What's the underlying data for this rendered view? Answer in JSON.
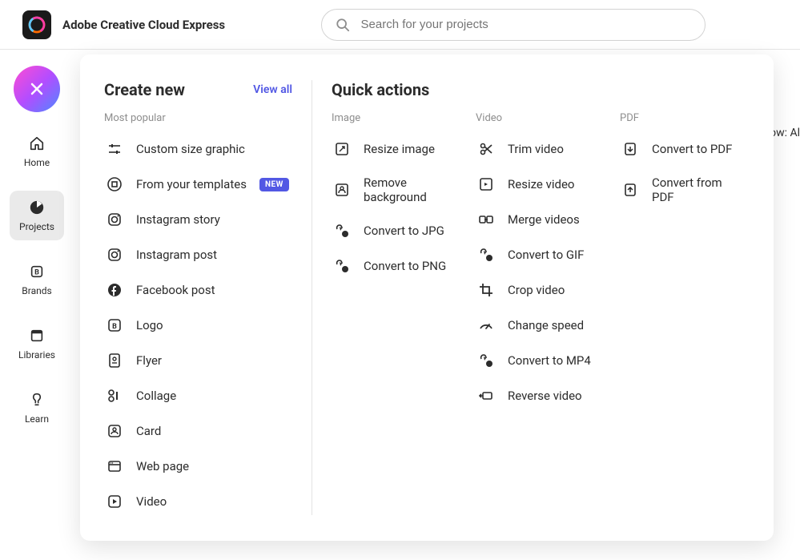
{
  "header": {
    "title": "Adobe Creative Cloud Express",
    "search_placeholder": "Search for your projects"
  },
  "sidebar": {
    "items": [
      {
        "label": "Home",
        "icon": "home-icon"
      },
      {
        "label": "Projects",
        "icon": "projects-icon",
        "active": true
      },
      {
        "label": "Brands",
        "icon": "brands-icon"
      },
      {
        "label": "Libraries",
        "icon": "libraries-icon"
      },
      {
        "label": "Learn",
        "icon": "learn-icon"
      }
    ]
  },
  "background_sliver": "ow: Al",
  "panel": {
    "create": {
      "title": "Create new",
      "view_all": "View all",
      "sub_label": "Most popular",
      "new_badge": "NEW",
      "items": [
        {
          "label": "Custom size graphic"
        },
        {
          "label": "From your templates",
          "new": true
        },
        {
          "label": "Instagram story"
        },
        {
          "label": "Instagram post"
        },
        {
          "label": "Facebook post"
        },
        {
          "label": "Logo"
        },
        {
          "label": "Flyer"
        },
        {
          "label": "Collage"
        },
        {
          "label": "Card"
        },
        {
          "label": "Web page"
        },
        {
          "label": "Video"
        }
      ]
    },
    "quick": {
      "title": "Quick actions",
      "columns": {
        "image": {
          "label": "Image",
          "items": [
            {
              "label": "Resize image"
            },
            {
              "label": "Remove background"
            },
            {
              "label": "Convert to JPG"
            },
            {
              "label": "Convert to PNG"
            }
          ]
        },
        "video": {
          "label": "Video",
          "items": [
            {
              "label": "Trim video"
            },
            {
              "label": "Resize video"
            },
            {
              "label": "Merge videos"
            },
            {
              "label": "Convert to GIF"
            },
            {
              "label": "Crop video"
            },
            {
              "label": "Change speed"
            },
            {
              "label": "Convert to MP4"
            },
            {
              "label": "Reverse video"
            }
          ]
        },
        "pdf": {
          "label": "PDF",
          "items": [
            {
              "label": "Convert to PDF"
            },
            {
              "label": "Convert from PDF"
            }
          ]
        }
      }
    }
  }
}
